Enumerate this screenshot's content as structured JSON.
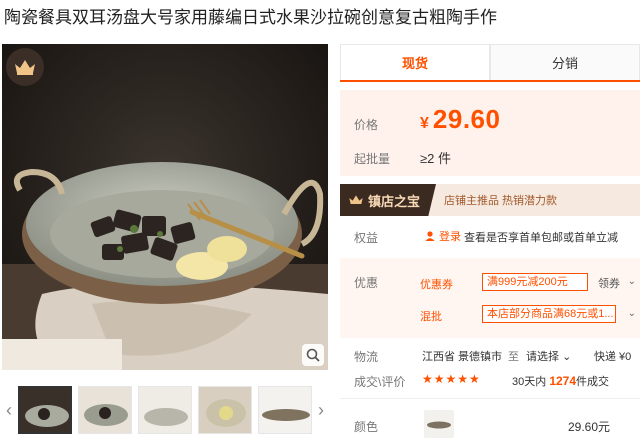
{
  "product": {
    "title": "陶瓷餐具双耳汤盘大号家用藤编日式水果沙拉碗创意复古粗陶手作"
  },
  "tabs": [
    {
      "label": "现货",
      "active": true
    },
    {
      "label": "分销",
      "active": false
    }
  ],
  "price": {
    "label": "价格",
    "currency": "¥",
    "value": "29.60",
    "moq_label": "起批量",
    "moq_value": "≥2 件"
  },
  "guard": {
    "badge": "镇店之宝",
    "text": "店铺主推品  热销潜力款"
  },
  "benefit": {
    "label": "权益",
    "login": "登录",
    "text": "查看是否享首单包邮或首单立减"
  },
  "promo": {
    "label": "优惠",
    "items": [
      {
        "name": "优惠券",
        "tag": "满999元减200元",
        "claim": "领券"
      },
      {
        "name": "混批",
        "tag": "本店部分商品满68元或1..."
      }
    ]
  },
  "shipping": {
    "label": "物流",
    "origin": "江西省 景德镇市",
    "to": "至",
    "dest": "请选择",
    "speed": "快递 ¥0"
  },
  "trade": {
    "label": "成交\\评价",
    "stars": "★★★★★",
    "rating": 5,
    "prefix": "30天内",
    "count": "1274",
    "suffix": "件成交"
  },
  "color": {
    "label": "颜色",
    "price": "29.60元"
  },
  "icons": {
    "badge": "crown-icon",
    "zoom": "search-icon",
    "prev": "chevron-left-icon",
    "next": "chevron-right-icon",
    "login": "user-icon"
  },
  "colors": {
    "accent": "#ff5000",
    "guard_bg": "#3b2a20"
  }
}
